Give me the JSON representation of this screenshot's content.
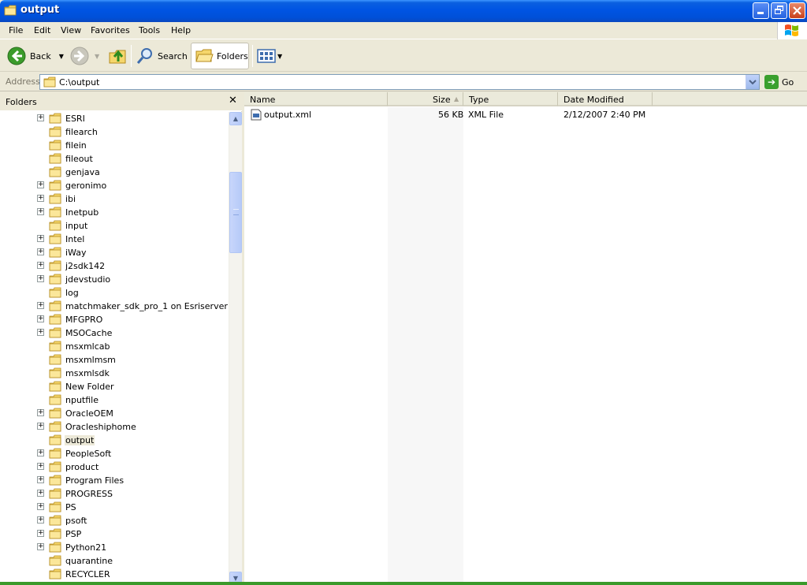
{
  "window": {
    "title": "output"
  },
  "menu": [
    "File",
    "Edit",
    "View",
    "Favorites",
    "Tools",
    "Help"
  ],
  "toolbar": {
    "back_label": "Back",
    "search_label": "Search",
    "folders_label": "Folders"
  },
  "address": {
    "label": "Address",
    "value": "C:\\output",
    "go_label": "Go"
  },
  "folders_pane": {
    "title": "Folders",
    "close_glyph": "✕",
    "items": [
      {
        "label": "ESRI",
        "expandable": true
      },
      {
        "label": "filearch",
        "expandable": false
      },
      {
        "label": "filein",
        "expandable": false
      },
      {
        "label": "fileout",
        "expandable": false
      },
      {
        "label": "genjava",
        "expandable": false
      },
      {
        "label": "geronimo",
        "expandable": true
      },
      {
        "label": "ibi",
        "expandable": true
      },
      {
        "label": "Inetpub",
        "expandable": true
      },
      {
        "label": "input",
        "expandable": false
      },
      {
        "label": "Intel",
        "expandable": true
      },
      {
        "label": "iWay",
        "expandable": true
      },
      {
        "label": "j2sdk142",
        "expandable": true
      },
      {
        "label": "jdevstudio",
        "expandable": true
      },
      {
        "label": "log",
        "expandable": false
      },
      {
        "label": "matchmaker_sdk_pro_1 on Esriserver",
        "expandable": true
      },
      {
        "label": "MFGPRO",
        "expandable": true
      },
      {
        "label": "MSOCache",
        "expandable": true
      },
      {
        "label": "msxmlcab",
        "expandable": false
      },
      {
        "label": "msxmlmsm",
        "expandable": false
      },
      {
        "label": "msxmlsdk",
        "expandable": false
      },
      {
        "label": "New Folder",
        "expandable": false
      },
      {
        "label": "nputfile",
        "expandable": false
      },
      {
        "label": "OracleOEM",
        "expandable": true
      },
      {
        "label": "Oracleshiphome",
        "expandable": true
      },
      {
        "label": "output",
        "expandable": false,
        "selected": true
      },
      {
        "label": "PeopleSoft",
        "expandable": true
      },
      {
        "label": "product",
        "expandable": true
      },
      {
        "label": "Program Files",
        "expandable": true
      },
      {
        "label": "PROGRESS",
        "expandable": true
      },
      {
        "label": "PS",
        "expandable": true
      },
      {
        "label": "psoft",
        "expandable": true
      },
      {
        "label": "PSP",
        "expandable": true
      },
      {
        "label": "Python21",
        "expandable": true
      },
      {
        "label": "quarantine",
        "expandable": false
      },
      {
        "label": "RECYCLER",
        "expandable": false
      }
    ]
  },
  "file_list": {
    "columns": [
      "Name",
      "Size",
      "Type",
      "Date Modified"
    ],
    "rows": [
      {
        "name": "output.xml",
        "size": "56 KB",
        "type": "XML File",
        "modified": "2/12/2007 2:40 PM"
      }
    ]
  },
  "colors": {
    "titlebar": "#0054E3",
    "chrome": "#ECE9D8",
    "folder": "#F5D66B"
  }
}
